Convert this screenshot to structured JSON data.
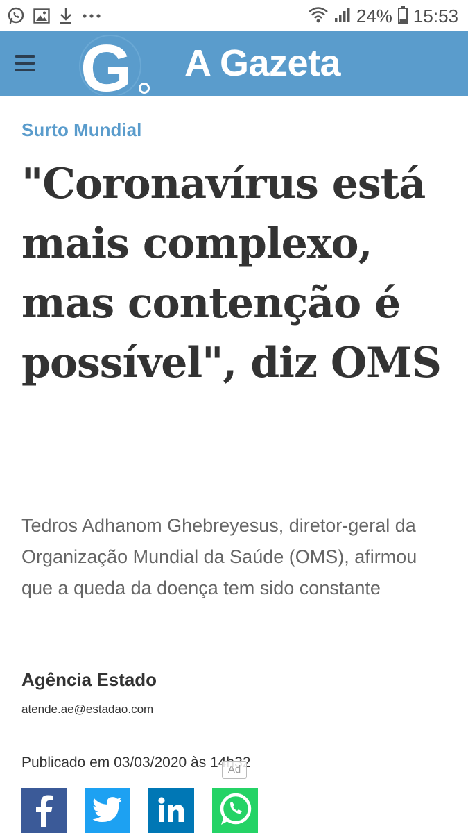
{
  "status_bar": {
    "battery": "24%",
    "time": "15:53",
    "icons": [
      "whatsapp-notification-icon",
      "gallery-notification-icon",
      "download-icon",
      "more-notifications-icon",
      "wifi-icon",
      "signal-icon",
      "battery-icon"
    ]
  },
  "header": {
    "logo_letter": "G",
    "brand": "A Gazeta",
    "colors": {
      "background": "#5a9ccc",
      "brand_text": "#ffffff",
      "menu_icon": "#2c3e50"
    }
  },
  "article": {
    "kicker": "Surto Mundial",
    "headline": "\"Coronavírus está mais complexo, mas contenção é possível\", diz OMS",
    "subtitle": "Tedros Adhanom Ghebreyesus, diretor-geral da Organização Mundial da Saúde (OMS), afirmou que a queda da doença tem sido constante",
    "author": "Agência Estado",
    "author_email": "atende.ae@estadao.com",
    "published": "Publicado em 03/03/2020 às 14h32",
    "ad_badge": "Ad",
    "colors": {
      "kicker": "#5a9ccc",
      "headline": "#333333",
      "subtitle": "#666666"
    }
  },
  "share": {
    "buttons": [
      {
        "network": "facebook",
        "icon": "facebook-icon",
        "color": "#3b5a98"
      },
      {
        "network": "twitter",
        "icon": "twitter-icon",
        "color": "#1da1f2"
      },
      {
        "network": "linkedin",
        "icon": "linkedin-icon",
        "color": "#0077b5"
      },
      {
        "network": "whatsapp",
        "icon": "whatsapp-icon",
        "color": "#25d366"
      }
    ]
  }
}
